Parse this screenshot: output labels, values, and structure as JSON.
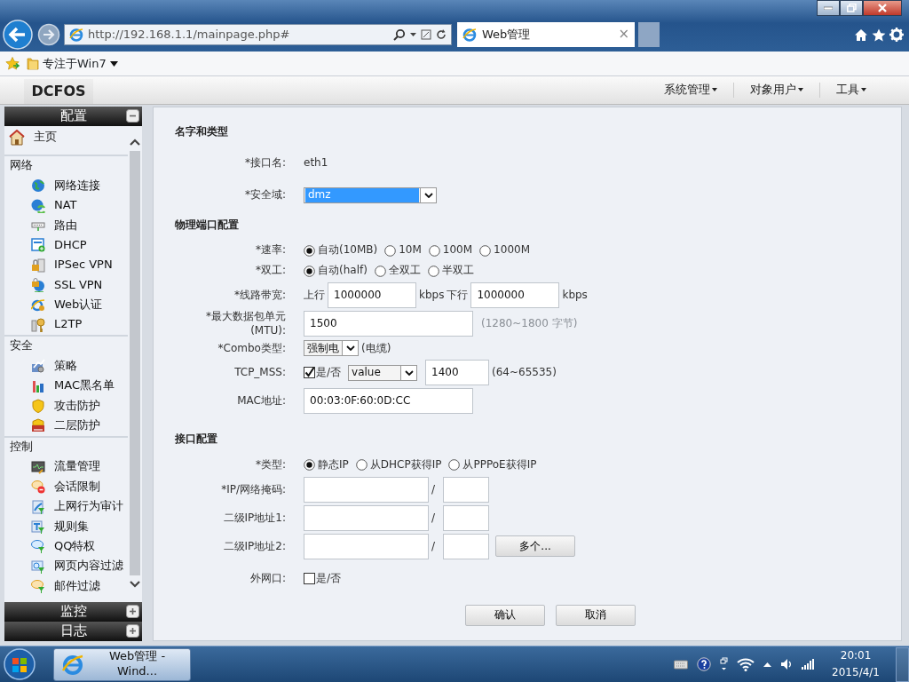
{
  "browser": {
    "address": "http://192.168.1.1/mainpage.php#",
    "tab_title": "Web管理",
    "tab_close": "×"
  },
  "favorites": [
    {
      "label": "专注于Win7"
    }
  ],
  "app": {
    "logo": "DCFOS",
    "menu": [
      {
        "label": "系统管理"
      },
      {
        "label": "对象用户"
      },
      {
        "label": "工具"
      }
    ]
  },
  "sidebar": {
    "title": "配置",
    "expanded": true,
    "home": {
      "label": "主页"
    },
    "groups": [
      {
        "title": "网络",
        "items": [
          {
            "label": "网络连接"
          },
          {
            "label": "NAT"
          },
          {
            "label": "路由"
          },
          {
            "label": "DHCP"
          },
          {
            "label": "IPSec VPN"
          },
          {
            "label": "SSL VPN"
          },
          {
            "label": "Web认证"
          },
          {
            "label": "L2TP"
          }
        ]
      },
      {
        "title": "安全",
        "items": [
          {
            "label": "策略"
          },
          {
            "label": "MAC黑名单"
          },
          {
            "label": "攻击防护"
          },
          {
            "label": "二层防护"
          }
        ]
      },
      {
        "title": "控制",
        "items": [
          {
            "label": "流量管理"
          },
          {
            "label": "会话限制"
          },
          {
            "label": "上网行为审计"
          },
          {
            "label": "规则集"
          },
          {
            "label": "QQ特权"
          },
          {
            "label": "网页内容过滤"
          },
          {
            "label": "邮件过滤"
          }
        ]
      }
    ],
    "panels": [
      {
        "title": "监控",
        "expanded": false
      },
      {
        "title": "日志",
        "expanded": false
      }
    ]
  },
  "form": {
    "sections": [
      {
        "title": "名字和类型",
        "rows": [
          {
            "label": "*接口名:",
            "parts": [
              {
                "kind": "value",
                "text": "eth1"
              }
            ]
          },
          {
            "label": "*安全域:",
            "parts": [
              {
                "kind": "select_wide",
                "value": "dmz",
                "focused": true
              }
            ]
          }
        ]
      },
      {
        "title": "物理端口配置",
        "rows": [
          {
            "label": "*速率:",
            "parts": [
              {
                "kind": "radio",
                "label": "自动(10MB)",
                "selected": true
              },
              {
                "kind": "radio",
                "label": "10M",
                "selected": false
              },
              {
                "kind": "radio",
                "label": "100M",
                "selected": false
              },
              {
                "kind": "radio",
                "label": "1000M",
                "selected": false
              }
            ]
          },
          {
            "label": "*双工:",
            "parts": [
              {
                "kind": "radio",
                "label": "自动(half)",
                "selected": true
              },
              {
                "kind": "radio",
                "label": "全双工",
                "selected": false
              },
              {
                "kind": "radio",
                "label": "半双工",
                "selected": false
              }
            ]
          },
          {
            "label": "*线路带宽:",
            "parts": [
              {
                "kind": "text",
                "text": "上行"
              },
              {
                "kind": "input",
                "value": "1000000"
              },
              {
                "kind": "text",
                "text": "kbps"
              },
              {
                "kind": "text",
                "text": "下行"
              },
              {
                "kind": "input",
                "value": "1000000"
              },
              {
                "kind": "text",
                "text": "kbps"
              }
            ]
          },
          {
            "label": "*最大数据包单元(MTU):",
            "parts": [
              {
                "kind": "input_wide",
                "value": "1500"
              },
              {
                "kind": "hint",
                "text": "(1280~1800 字节)"
              }
            ]
          },
          {
            "label": "*Combo类型:",
            "parts": [
              {
                "kind": "select",
                "value": "强制电",
                "focused": false
              },
              {
                "kind": "text",
                "text": "(电缆)"
              }
            ]
          },
          {
            "label": "TCP_MSS:",
            "parts": [
              {
                "kind": "checkbox",
                "label": "是/否",
                "checked": true
              },
              {
                "kind": "select_medium",
                "value": "value",
                "focused": false
              },
              {
                "kind": "input_medium",
                "value": "1400"
              },
              {
                "kind": "text",
                "text": "(64~65535)"
              }
            ]
          },
          {
            "label": "MAC地址:",
            "parts": [
              {
                "kind": "input_wide",
                "value": "00:03:0F:60:0D:CC"
              }
            ]
          }
        ]
      },
      {
        "title": "接口配置",
        "rows": [
          {
            "label": "*类型:",
            "parts": [
              {
                "kind": "radio",
                "label": "静态IP",
                "selected": true
              },
              {
                "kind": "radio",
                "label": "从DHCP获得IP",
                "selected": false
              },
              {
                "kind": "radio",
                "label": "从PPPoE获得IP",
                "selected": false
              }
            ]
          },
          {
            "label": "*IP/网络掩码:",
            "parts": [
              {
                "kind": "input_ip"
              },
              {
                "kind": "text",
                "text": "/"
              },
              {
                "kind": "input_short"
              }
            ]
          },
          {
            "label": "二级IP地址1:",
            "parts": [
              {
                "kind": "input_ip"
              },
              {
                "kind": "text",
                "text": "/"
              },
              {
                "kind": "input_short"
              }
            ]
          },
          {
            "label": "二级IP地址2:",
            "parts": [
              {
                "kind": "input_ip"
              },
              {
                "kind": "text",
                "text": "/"
              },
              {
                "kind": "input_short"
              },
              {
                "kind": "button",
                "label": "多个..."
              }
            ]
          },
          {
            "label": "外网口:",
            "parts": [
              {
                "kind": "checkbox",
                "label": "是/否",
                "checked": false
              }
            ]
          }
        ]
      }
    ],
    "buttons": [
      {
        "label": "确认"
      },
      {
        "label": "取消"
      }
    ]
  },
  "taskbar": {
    "window_label": "Web管理 - Wind...",
    "time": "20:01",
    "date": "2015/4/1"
  }
}
